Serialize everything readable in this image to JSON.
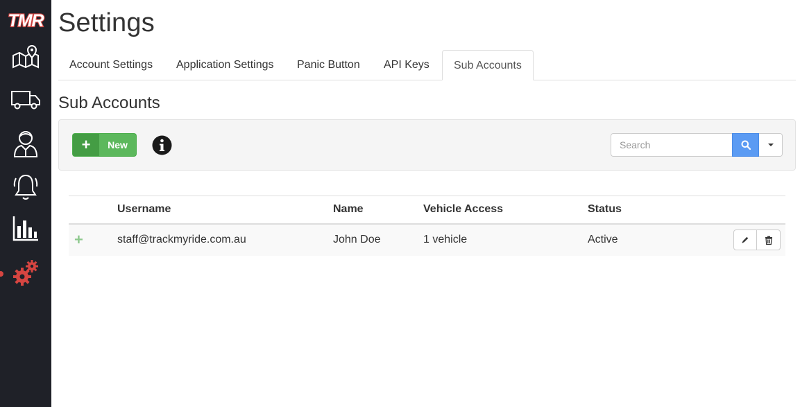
{
  "app": {
    "logo_text": "TMR",
    "page_title": "Settings"
  },
  "sidebar": {
    "items": [
      {
        "icon": "map-pin-icon"
      },
      {
        "icon": "truck-icon"
      },
      {
        "icon": "driver-icon"
      },
      {
        "icon": "bell-icon"
      },
      {
        "icon": "bar-chart-icon"
      },
      {
        "icon": "gears-icon",
        "active": true
      }
    ]
  },
  "tabs": [
    {
      "label": "Account Settings"
    },
    {
      "label": "Application Settings"
    },
    {
      "label": "Panic Button"
    },
    {
      "label": "API Keys"
    },
    {
      "label": "Sub Accounts",
      "active": true
    }
  ],
  "section": {
    "title": "Sub Accounts"
  },
  "toolbar": {
    "new_label": "New",
    "new_icon": "plus-icon",
    "info_icon": "info-icon",
    "search_placeholder": "Search",
    "search_value": ""
  },
  "table": {
    "columns": [
      "",
      "Username",
      "Name",
      "Vehicle Access",
      "Status",
      ""
    ],
    "rows": [
      {
        "expand": "+",
        "username": "staff@trackmyride.com.au",
        "name": "John Doe",
        "vehicle_access": "1 vehicle",
        "status": "Active"
      }
    ]
  },
  "colors": {
    "sidebar_bg": "#1f2128",
    "accent_red": "#d64541",
    "success_green": "#5cb85c",
    "primary_blue": "#5b9bf3"
  }
}
